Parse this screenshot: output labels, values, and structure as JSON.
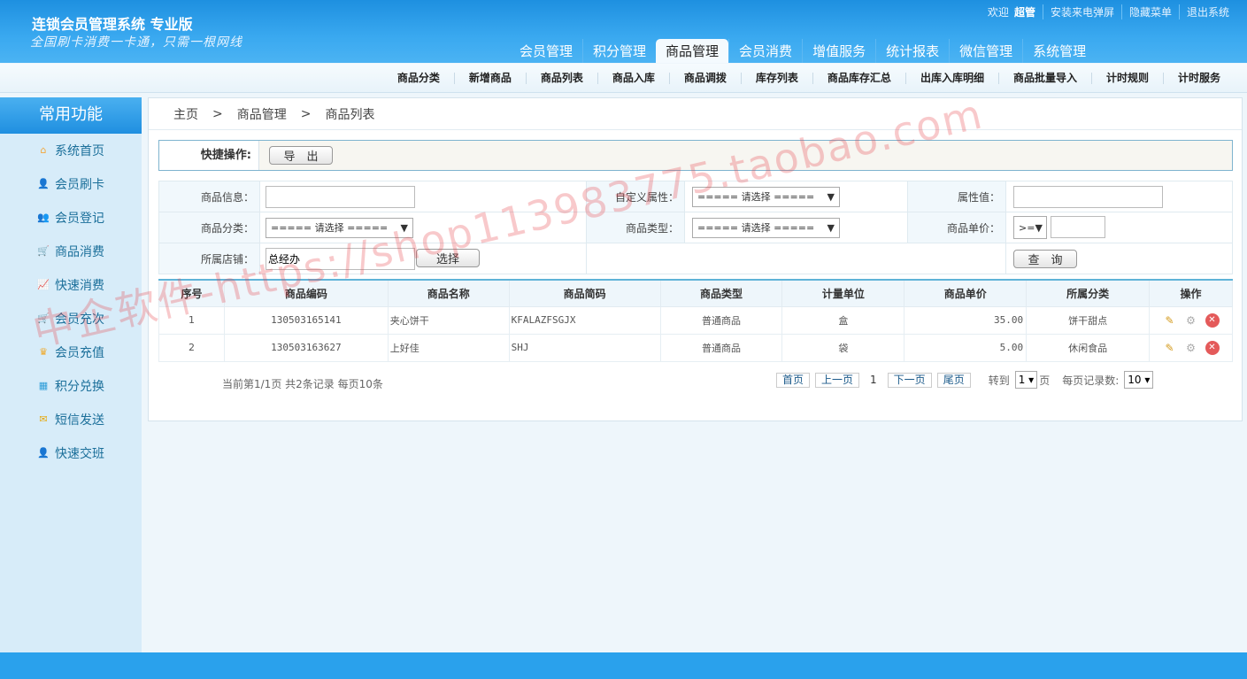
{
  "header": {
    "title": "连锁会员管理系统 专业版",
    "slogan": "全国刷卡消费一卡通，只需一根网线",
    "toplinks": {
      "welcome": "欢迎",
      "user": "超管",
      "popup": "安装来电弹屏",
      "hide_menu": "隐藏菜单",
      "logout": "退出系统"
    },
    "nav": [
      "会员管理",
      "积分管理",
      "商品管理",
      "会员消费",
      "增值服务",
      "统计报表",
      "微信管理",
      "系统管理"
    ],
    "active_nav": "商品管理"
  },
  "subnav": [
    "商品分类",
    "新增商品",
    "商品列表",
    "商品入库",
    "商品调拨",
    "库存列表",
    "商品库存汇总",
    "出库入库明细",
    "商品批量导入",
    "计时规则",
    "计时服务"
  ],
  "sidebar": {
    "title": "常用功能",
    "items": [
      {
        "label": "系统首页",
        "icon": "home-icon"
      },
      {
        "label": "会员刷卡",
        "icon": "card-swipe-icon"
      },
      {
        "label": "会员登记",
        "icon": "users-icon"
      },
      {
        "label": "商品消费",
        "icon": "cart-icon"
      },
      {
        "label": "快速消费",
        "icon": "chart-icon"
      },
      {
        "label": "会员充次",
        "icon": "cart-refill-icon"
      },
      {
        "label": "会员充值",
        "icon": "crown-icon"
      },
      {
        "label": "积分兑换",
        "icon": "gift-icon"
      },
      {
        "label": "短信发送",
        "icon": "mail-icon"
      },
      {
        "label": "快速交班",
        "icon": "user-handover-icon"
      }
    ]
  },
  "breadcrumb": [
    "主页",
    "商品管理",
    "商品列表"
  ],
  "breadcrumb_sep": ">",
  "quick": {
    "label": "快捷操作:",
    "export": "导　出"
  },
  "filters": {
    "info_label": "商品信息：",
    "info_value": "",
    "attr_label": "自定义属性：",
    "attr_value": "===== 请选择 =====",
    "attrval_label": "属性值：",
    "attrval_value": "",
    "cat_label": "商品分类：",
    "cat_value": "===== 请选择 =====",
    "type_label": "商品类型：",
    "type_value": "===== 请选择 =====",
    "price_label": "商品单价：",
    "price_op": ">=",
    "price_value": "",
    "store_label": "所属店铺：",
    "store_value": "总经办",
    "choose": "选择",
    "query": "查　询"
  },
  "table": {
    "columns": [
      "序号",
      "商品编码",
      "商品名称",
      "商品简码",
      "商品类型",
      "计量单位",
      "商品单价",
      "所属分类",
      "操作"
    ],
    "rows": [
      [
        "1",
        "130503165141",
        "夹心饼干",
        "KFALAZFSGJX",
        "普通商品",
        "盒",
        "35.00",
        "饼干甜点"
      ],
      [
        "2",
        "130503163627",
        "上好佳",
        "SHJ",
        "普通商品",
        "袋",
        "5.00",
        "休闲食品"
      ]
    ]
  },
  "pager": {
    "info": "当前第1/1页  共2条记录  每页10条",
    "first": "首页",
    "prev": "上一页",
    "current": "1",
    "next": "下一页",
    "last": "尾页",
    "goto": "转到",
    "goto_value": "1",
    "page": "页",
    "per_label": "每页记录数:",
    "per_value": "10"
  },
  "watermark": "中企软件-https://shop113983775.taobao.com"
}
